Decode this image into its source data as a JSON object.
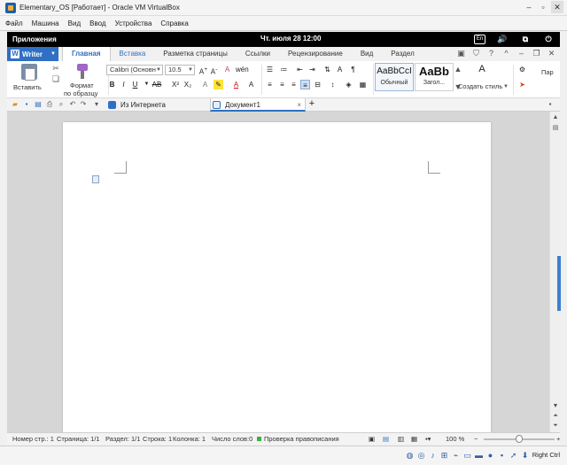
{
  "host_window": {
    "title": "Elementary_OS [Работает] - Oracle VM VirtualBox",
    "menu": [
      "Файл",
      "Машина",
      "Вид",
      "Ввод",
      "Устройства",
      "Справка"
    ],
    "controls": [
      "minimize-icon",
      "maximize-icon",
      "close-icon"
    ]
  },
  "os_panel": {
    "apps_label": "Приложения",
    "clock": "Чт. июля 28   12:00",
    "keyboard_indicator": "En"
  },
  "wps": {
    "app_button": "Writer",
    "tabs": [
      "Главная",
      "Вставка",
      "Разметка страницы",
      "Ссылки",
      "Рецензирование",
      "Вид",
      "Раздел"
    ],
    "active_tab": "Главная",
    "ribbon": {
      "paste_label": "Вставить",
      "format_painter_line1": "Формат",
      "format_painter_line2": "по образцу",
      "font_name": "Calibri (Основн",
      "font_size": "10.5",
      "bold": "B",
      "italic": "I",
      "underline": "U",
      "strike": "AB",
      "superscript": "X²",
      "subscript": "X₂",
      "styles": [
        {
          "preview": "AaBbCcI",
          "label": "Обычный"
        },
        {
          "preview": "AaBb",
          "label": "Загол..."
        }
      ],
      "create_style": "Создать стиль",
      "para_label": "Пар"
    },
    "doc_tabs": [
      {
        "label": "Из Интернета",
        "active": false
      },
      {
        "label": "Документ1",
        "active": true
      }
    ],
    "new_tab": "+"
  },
  "statusbar": {
    "page_number": "Номер стр.: 1",
    "page": "Страница: 1/1",
    "section": "Раздел: 1/1",
    "line": "Строка: 1",
    "column": "Колонка: 1",
    "word_count": "Число слов:0",
    "spell_check": "Проверка правописания",
    "zoom": "100 %",
    "zoom_level": 0.5
  },
  "host_status": {
    "right_ctrl": "Right Ctrl"
  },
  "colors": {
    "accent": "#2f6fc4",
    "panel": "#000000",
    "spell_ok": "#3cb043"
  }
}
